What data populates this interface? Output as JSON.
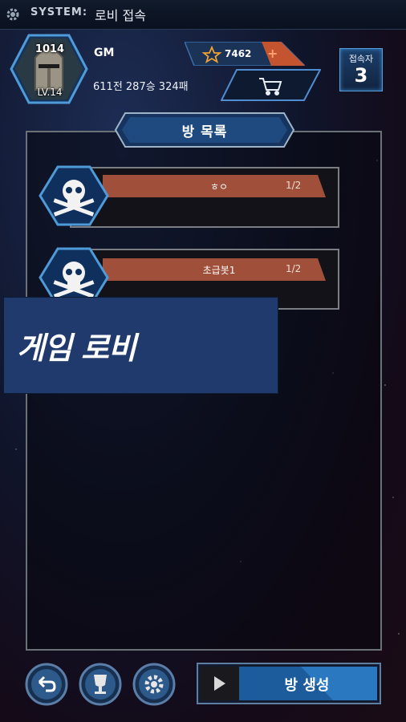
{
  "system_bar": {
    "label": "SYSTEM:",
    "message": "로비 접속"
  },
  "profile": {
    "rating": "1014",
    "level": "LV.14",
    "name": "GM",
    "record": "611전 287승 324패",
    "coins": "7462",
    "coin_add": "+"
  },
  "online": {
    "label": "접속자",
    "count": "3"
  },
  "room_list": {
    "title": "방 목록",
    "rooms": [
      {
        "name": "ㅎㅇ",
        "count": "1/2"
      },
      {
        "name": "초급봇1",
        "count": "1/2"
      }
    ]
  },
  "overlay_caption": "게임 로비",
  "bottom": {
    "create_room_label": "방 생성"
  },
  "colors": {
    "accent_blue": "#2d7fc7",
    "room_bar": "#a0503a",
    "caption_bg": "#213a6e"
  },
  "icons": [
    "gear-icon",
    "star-icon",
    "cart-icon",
    "skull-icon",
    "back-icon",
    "trophy-icon",
    "settings-icon",
    "play-icon"
  ]
}
